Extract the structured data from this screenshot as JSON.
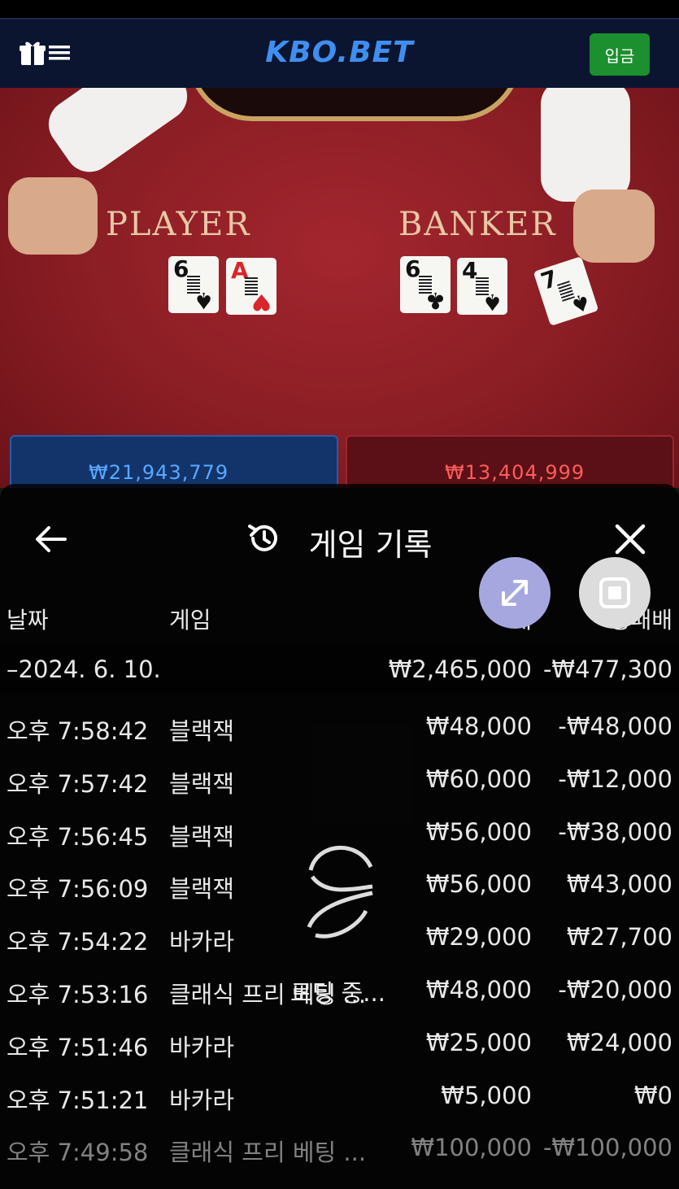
{
  "nav": {
    "brand": "KBO.BET",
    "deposit_label": "입금",
    "gift_icon": "gift-icon",
    "menu_icon": "menu-icon"
  },
  "table": {
    "player_label": "PLAYER",
    "banker_label": "BANKER",
    "player_cards": [
      {
        "rank": "6",
        "suit": "♠",
        "color": "blk"
      },
      {
        "rank": "A",
        "suit": "♥",
        "color": "red"
      }
    ],
    "banker_cards": [
      {
        "rank": "6",
        "suit": "♣",
        "color": "blk"
      },
      {
        "rank": "4",
        "suit": "♠",
        "color": "blk"
      },
      {
        "rank": "7",
        "suit": "♠",
        "color": "blk"
      }
    ],
    "player_total": "₩21,943,779",
    "banker_total": "₩13,404,999"
  },
  "history": {
    "title": "게임 기록",
    "columns": {
      "date": "날짜",
      "game": "게임",
      "bet": "배",
      "win": "승패배"
    },
    "date_group": {
      "date": "–2024. 6. 10.",
      "bet_total": "₩2,465,000",
      "win_total": "-₩477,300"
    },
    "rows": [
      {
        "time": "오후 7:58:42",
        "game": "블랙잭",
        "bet": "₩48,000",
        "win": "-₩48,000"
      },
      {
        "time": "오후 7:57:42",
        "game": "블랙잭",
        "bet": "₩60,000",
        "win": "-₩12,000"
      },
      {
        "time": "오후 7:56:45",
        "game": "블랙잭",
        "bet": "₩56,000",
        "win": "-₩38,000"
      },
      {
        "time": "오후 7:56:09",
        "game": "블랙잭",
        "bet": "₩56,000",
        "win": "₩43,000"
      },
      {
        "time": "오후 7:54:22",
        "game": "바카라",
        "bet": "₩29,000",
        "win": "₩27,700"
      },
      {
        "time": "오후 7:53:16",
        "game": "클래식 프리 베팅 ...",
        "bet": "₩48,000",
        "win": "-₩20,000"
      },
      {
        "time": "오후 7:51:46",
        "game": "바카라",
        "bet": "₩25,000",
        "win": "₩24,000"
      },
      {
        "time": "오후 7:51:21",
        "game": "바카라",
        "bet": "₩5,000",
        "win": "₩0"
      },
      {
        "time": "오후 7:49:58",
        "game": "클래식 프리 베팅 ...",
        "bet": "₩100,000",
        "win": "-₩100,000"
      }
    ],
    "loading_text": "로딩 중..."
  }
}
